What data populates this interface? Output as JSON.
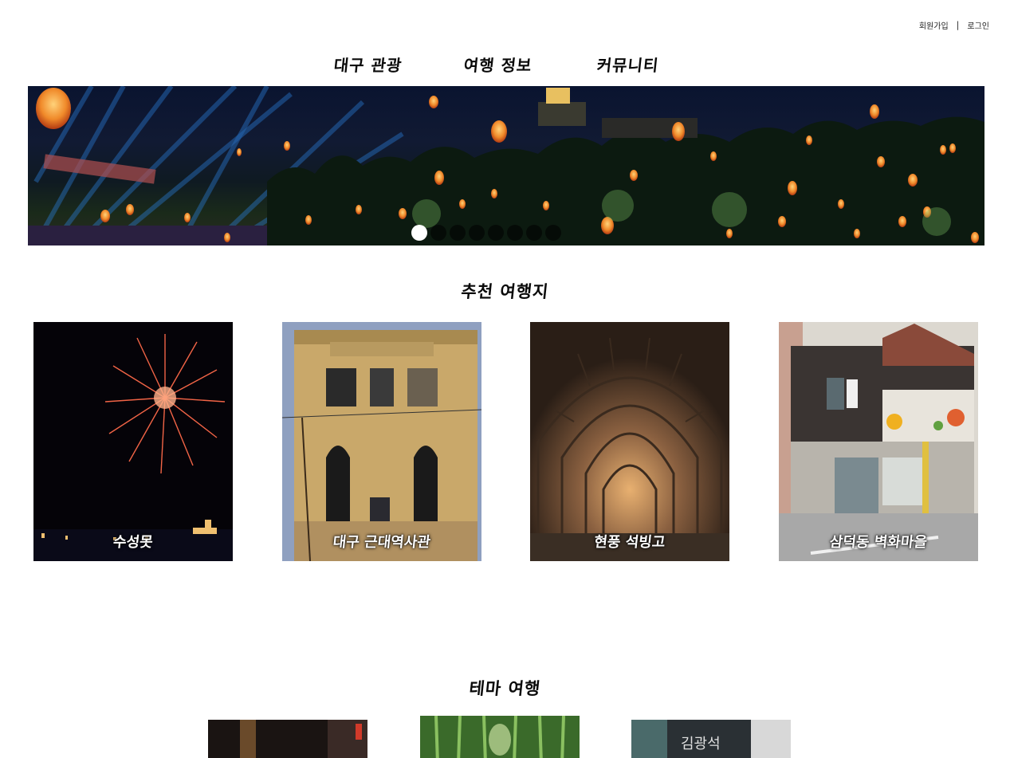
{
  "top_links": {
    "signup": "회원가입",
    "separator": "|",
    "login": "로그인"
  },
  "nav": {
    "items": [
      "대구 관광",
      "여행 정보",
      "커뮤니티"
    ]
  },
  "banner": {
    "slide_count": 8,
    "active_slide": 1
  },
  "recommended": {
    "title": "추천 여행지",
    "cards": [
      {
        "label": "수성못",
        "image": "fireworks-over-lake"
      },
      {
        "label": "대구 근대역사관",
        "image": "stone-heritage-building"
      },
      {
        "label": "현풍 석빙고",
        "image": "stone-arch-tunnel"
      },
      {
        "label": "삼덕동 벽화마을",
        "image": "mural-painted-building"
      }
    ]
  },
  "theme": {
    "title": "테마 여행",
    "cards": [
      {
        "image": "night-alley"
      },
      {
        "image": "bamboo-forest"
      },
      {
        "image": "signboard-wall",
        "sign_text": "김광석"
      }
    ]
  }
}
